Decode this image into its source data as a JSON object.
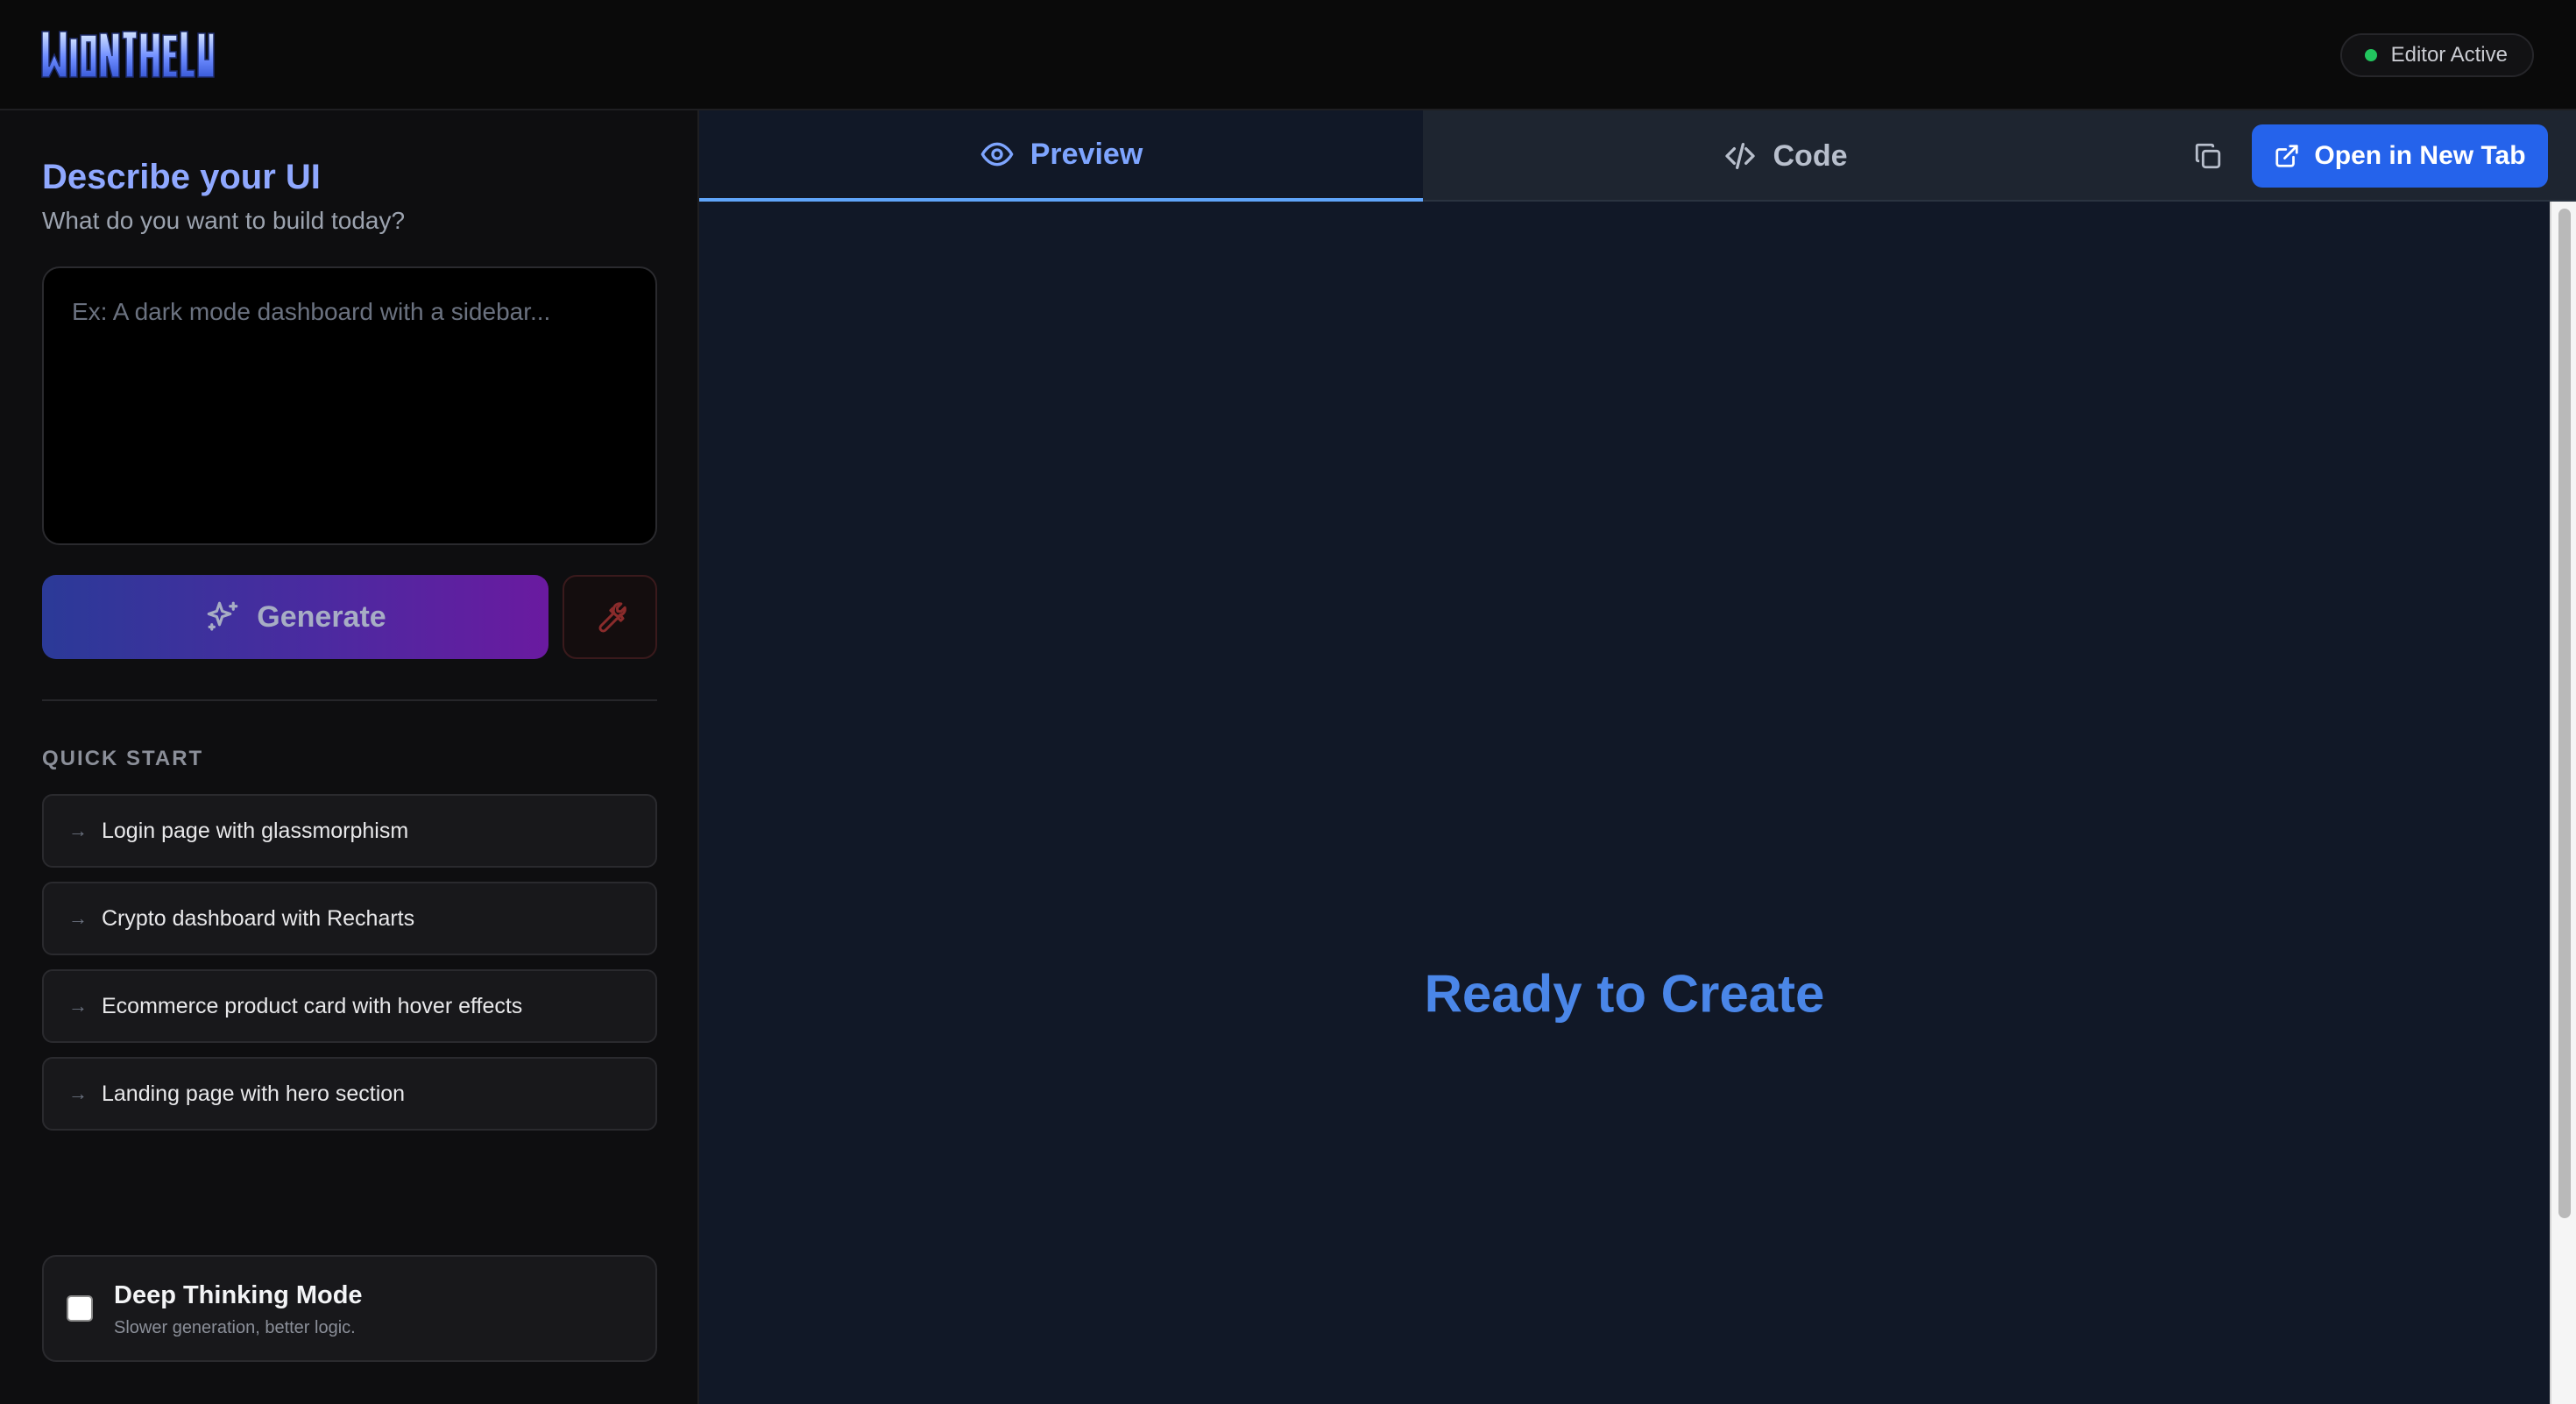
{
  "header": {
    "logo_text": "WONDERFUL",
    "status_label": "Editor Active",
    "status_color": "#22c55e"
  },
  "sidebar": {
    "title": "Describe your UI",
    "subtitle": "What do you want to build today?",
    "prompt_placeholder": "Ex: A dark mode dashboard with a sidebar...",
    "generate_label": "Generate",
    "quick_start_heading": "QUICK START",
    "quick_start_items": [
      {
        "label": "Login page with glassmorphism"
      },
      {
        "label": "Crypto dashboard with Recharts"
      },
      {
        "label": "Ecommerce product card with hover effects"
      },
      {
        "label": "Landing page with hero section"
      }
    ],
    "deep_thinking": {
      "title": "Deep Thinking Mode",
      "subtitle": "Slower generation, better logic.",
      "checked": false
    }
  },
  "main": {
    "tabs": [
      {
        "label": "Preview",
        "active": true
      },
      {
        "label": "Code",
        "active": false
      }
    ],
    "open_new_tab_label": "Open in New Tab",
    "preview_message": "Ready to Create"
  },
  "colors": {
    "accent": "#2563eb",
    "title_blue": "#8fa8ff",
    "ready_blue": "#4a86e8"
  }
}
